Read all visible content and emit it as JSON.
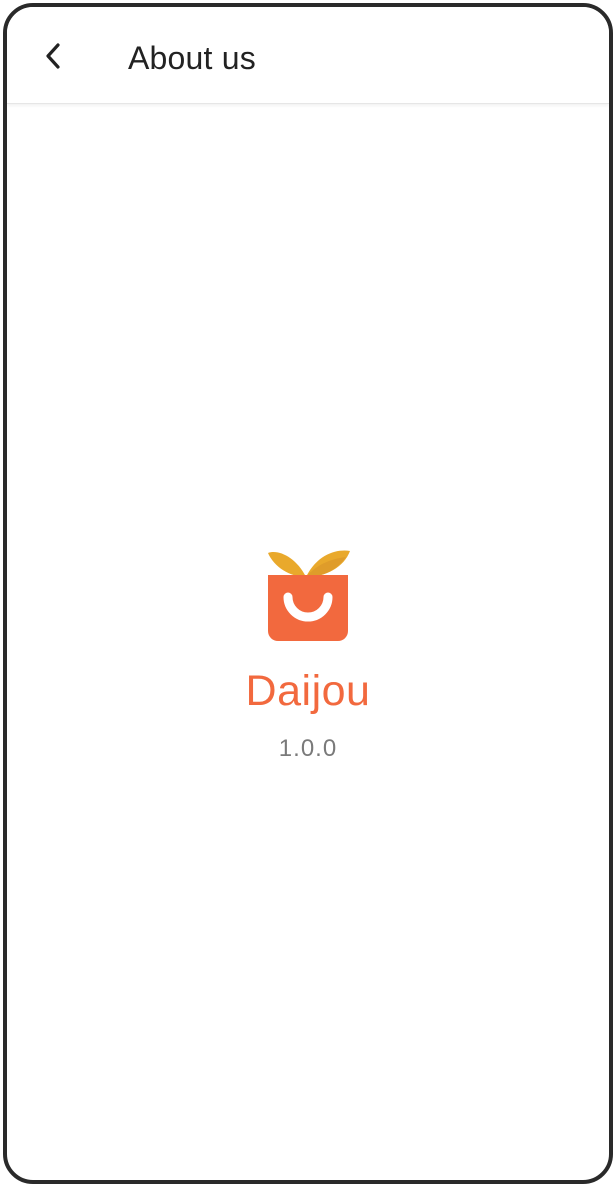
{
  "header": {
    "title": "About us",
    "back_icon": "chevron-left-icon"
  },
  "about": {
    "logo_icon": "shopping-bag-smile-logo",
    "app_name": "Daijou",
    "version": "1.0.0"
  },
  "colors": {
    "brand_orange": "#f2693e",
    "leaf_yellow": "#e9a92c",
    "text_primary": "#222222",
    "text_secondary": "#7a7a7a"
  }
}
